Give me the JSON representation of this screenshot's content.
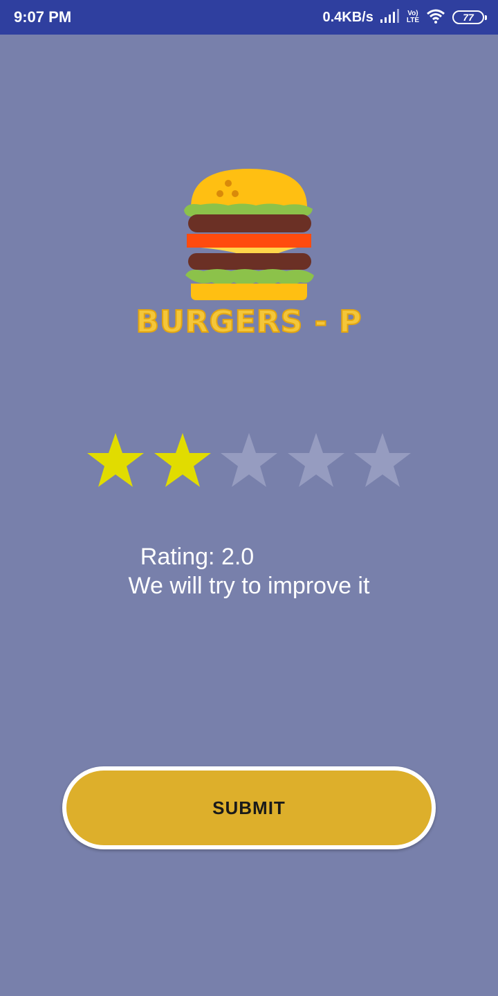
{
  "status_bar": {
    "time": "9:07 PM",
    "net_speed": "0.4KB/s",
    "volte_top": "Vo)",
    "volte_bottom": "LTE",
    "battery": "77"
  },
  "app": {
    "brand": "BURGERS - P",
    "logo_icon": "burger-icon"
  },
  "rating": {
    "value": 2,
    "max": 5,
    "filled_color": "#e1dc00",
    "empty_color": "#969cc0",
    "line1": "Rating: 2.0",
    "line2": "We will try to improve it"
  },
  "submit": {
    "label": "SUBMIT",
    "color": "#ddaf2b"
  }
}
